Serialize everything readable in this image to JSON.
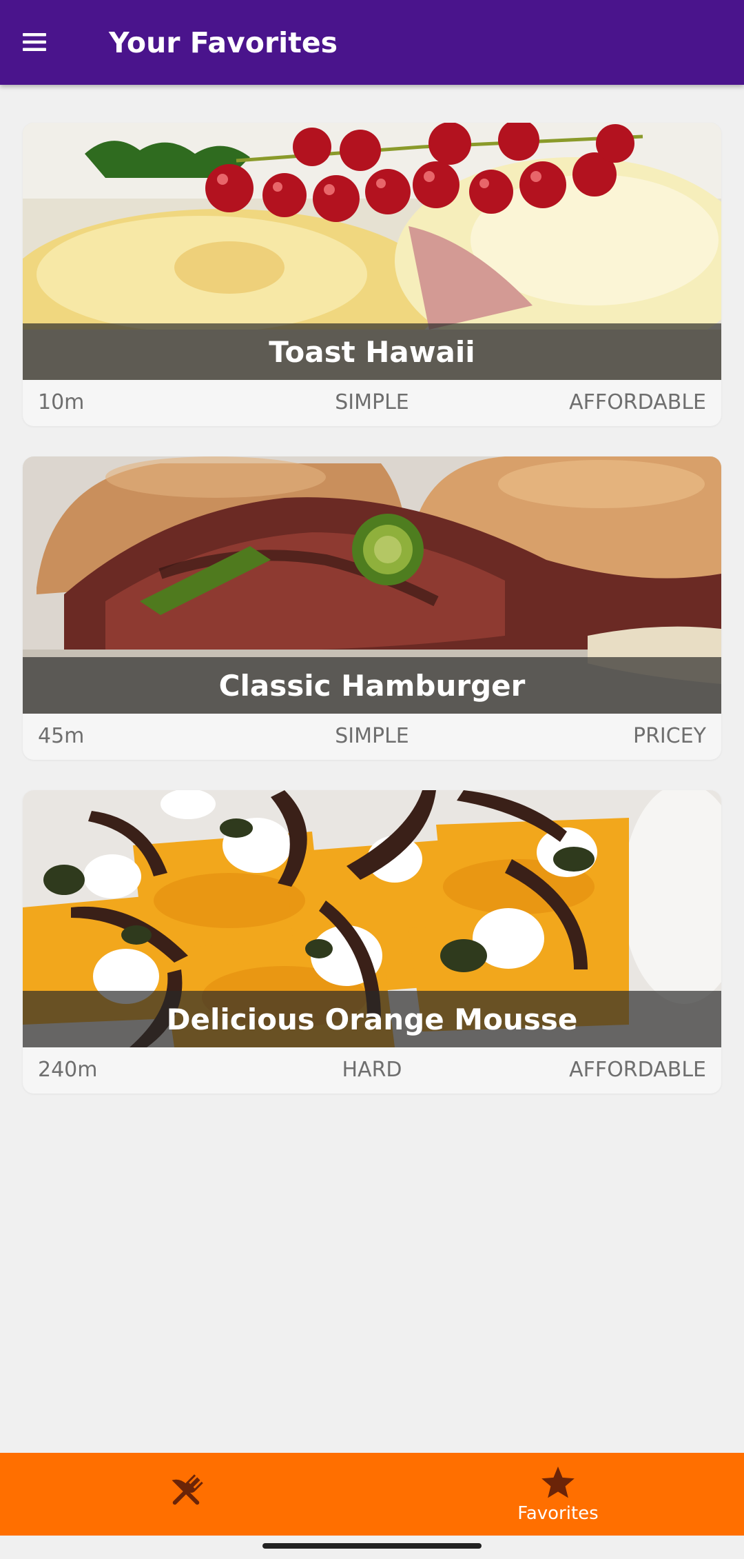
{
  "app": {
    "title": "Your Favorites",
    "accent_color": "#4a148c",
    "nav_color": "#ff6f00"
  },
  "appbar": {
    "menu_icon": "hamburger-menu-icon"
  },
  "meals": [
    {
      "title": "Toast Hawaii",
      "duration": "10m",
      "complexity": "SIMPLE",
      "affordability": "AFFORDABLE"
    },
    {
      "title": "Classic Hamburger",
      "duration": "45m",
      "complexity": "SIMPLE",
      "affordability": "PRICEY"
    },
    {
      "title": "Delicious Orange Mousse",
      "duration": "240m",
      "complexity": "HARD",
      "affordability": "AFFORDABLE"
    }
  ],
  "bottom_nav": {
    "items": [
      {
        "icon": "fork-knife-icon",
        "label": "",
        "selected": false
      },
      {
        "icon": "star-icon",
        "label": "Favorites",
        "selected": true
      }
    ]
  }
}
